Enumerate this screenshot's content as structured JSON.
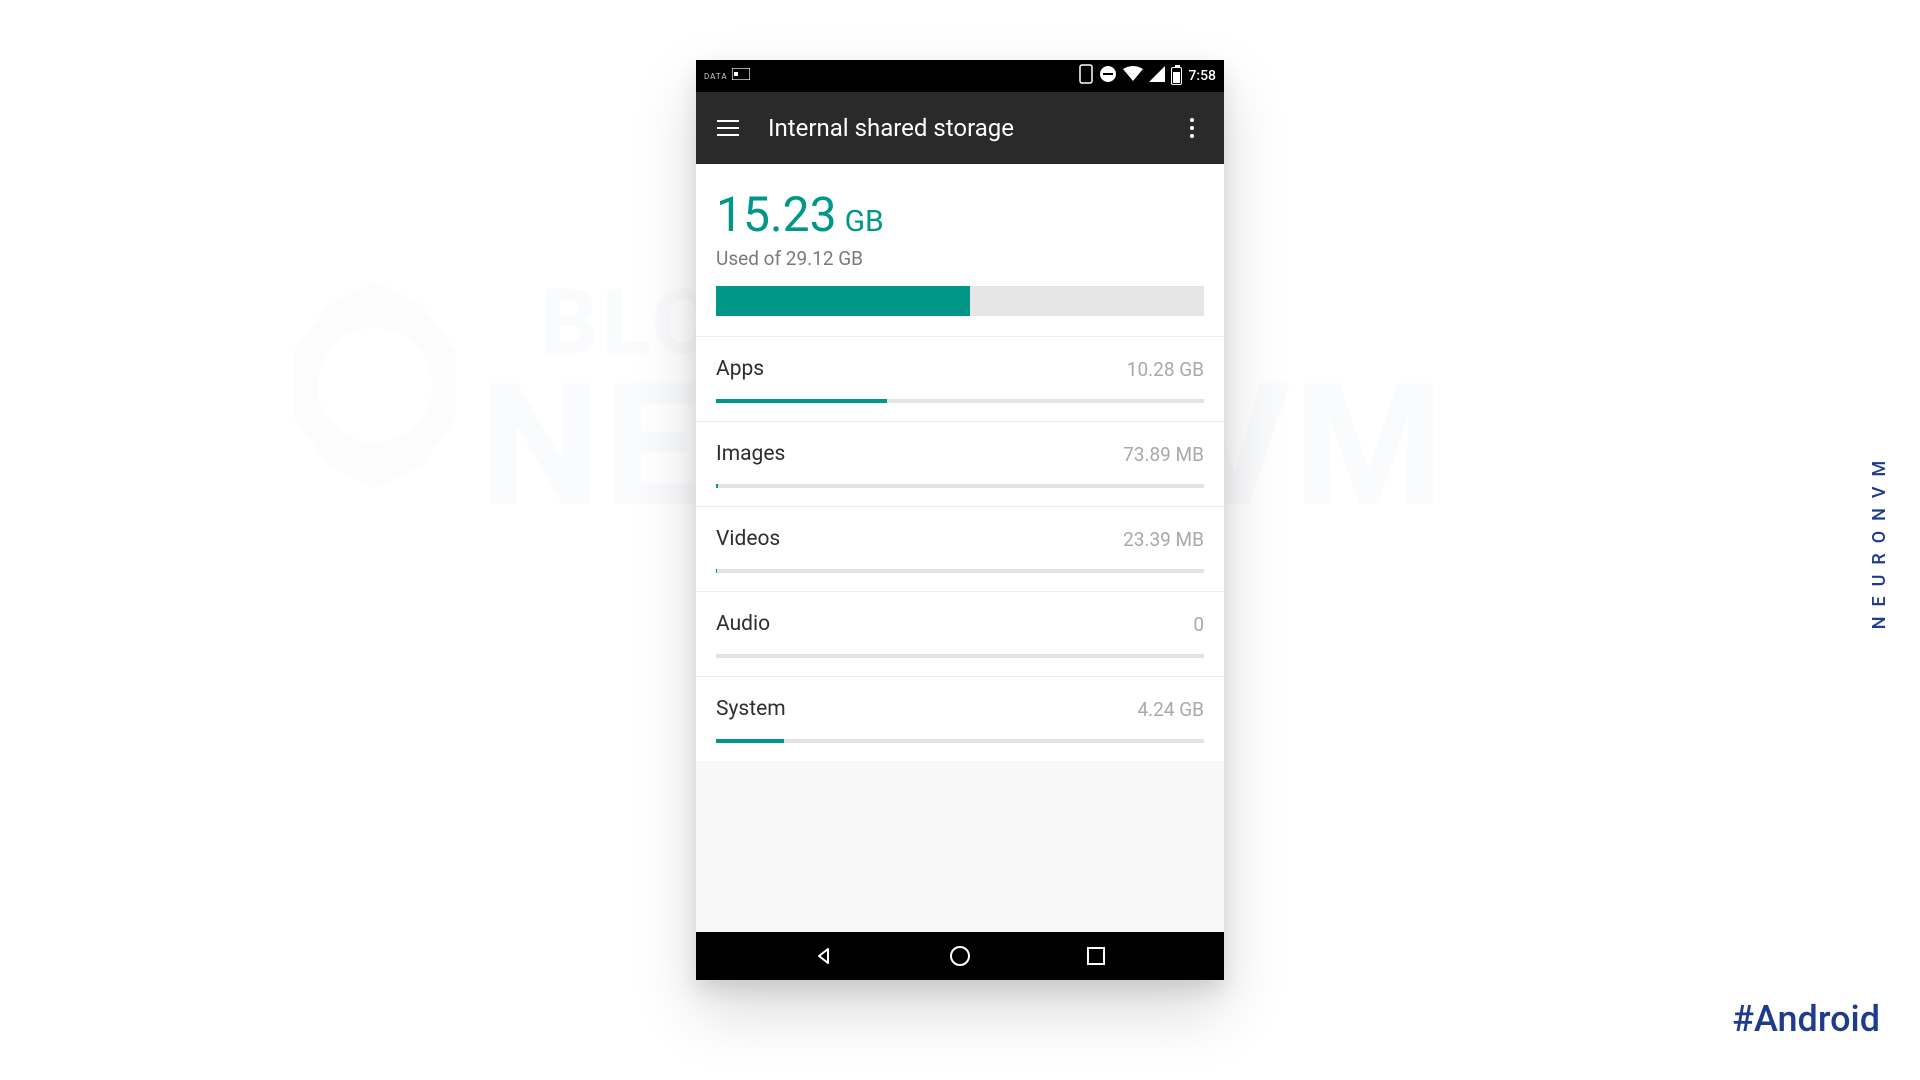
{
  "watermark": {
    "line1": "BLOG",
    "line2": "NEURONVM"
  },
  "brand_vertical": "NEURONVM",
  "hashtag": "#Android",
  "status": {
    "time": "7:58",
    "data_label": "DATA"
  },
  "appbar": {
    "title": "Internal shared storage"
  },
  "summary": {
    "used_value": "15.23",
    "used_unit": "GB",
    "caption": "Used of 29.12 GB",
    "used_pct": 52
  },
  "categories": [
    {
      "name": "Apps",
      "value": "10.28 GB",
      "pct": 35
    },
    {
      "name": "Images",
      "value": "73.89 MB",
      "pct": 0.5
    },
    {
      "name": "Videos",
      "value": "23.39 MB",
      "pct": 0.2
    },
    {
      "name": "Audio",
      "value": "0",
      "pct": 0
    },
    {
      "name": "System",
      "value": "4.24 GB",
      "pct": 14
    }
  ]
}
